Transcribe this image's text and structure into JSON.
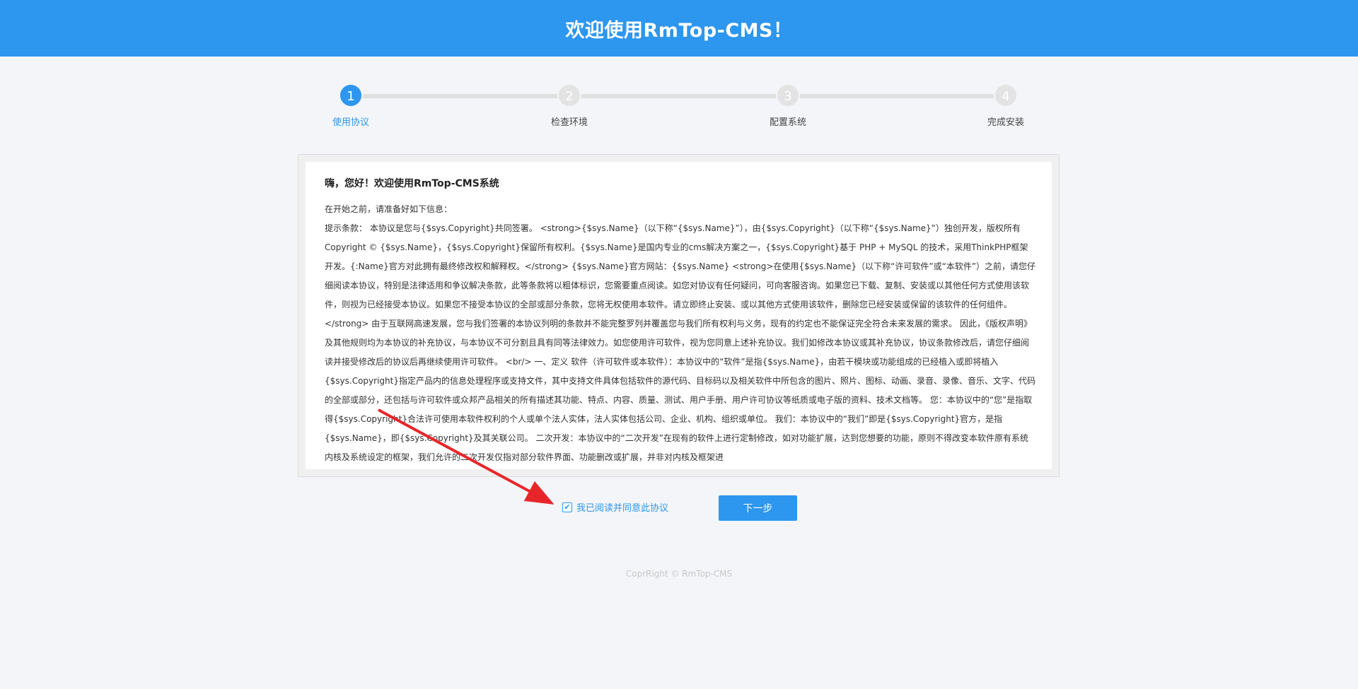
{
  "header": {
    "title": "欢迎使用RmTop-CMS！"
  },
  "steps": [
    {
      "number": "1",
      "label": "使用协议",
      "active": true
    },
    {
      "number": "2",
      "label": "检查环境",
      "active": false
    },
    {
      "number": "3",
      "label": "配置系统",
      "active": false
    },
    {
      "number": "4",
      "label": "完成安装",
      "active": false
    }
  ],
  "agreement": {
    "title": "嗨，您好！欢迎使用RmTop-CMS系统",
    "intro": "在开始之前，请准备好如下信息：",
    "body": "提示条款： 本协议是您与{$sys.Copyright}共同签署。 <strong>{$sys.Name}（以下称“{$sys.Name}”），由{$sys.Copyright}（以下称“{$sys.Name}”）独创开发，版权所有Copyright © {$sys.Name}，{$sys.Copyright}保留所有权利。{$sys.Name}是国内专业的cms解决方案之一，{$sys.Copyright}基于 PHP + MySQL 的技术，采用ThinkPHP框架开发。{:Name}官方对此拥有最终修改权和解释权。</strong> {$sys.Name}官方网站：{$sys.Name} <strong>在使用{$sys.Name}（以下称“许可软件”或“本软件”）之前，请您仔细阅读本协议，特别是法律适用和争议解决条款，此等条款将以粗体标识，您需要重点阅读。如您对协议有任何疑问，可向客服咨询。如果您已下载、复制、安装或以其他任何方式使用该软件，则视为已经接受本协议。如果您不接受本协议的全部或部分条款，您将无权使用本软件。请立即终止安装、或以其他方式使用该软件，删除您已经安装或保留的该软件的任何组件。</strong> 由于互联网高速发展，您与我们签署的本协议列明的条款并不能完整罗列并覆盖您与我们所有权利与义务，现有的约定也不能保证完全符合未来发展的需求。 因此，《版权声明》及其他规则均为本协议的补充协议，与本协议不可分割且具有同等法律效力。如您使用许可软件，视为您同意上述补充协议。我们如修改本协议或其补充协议，协议条款修改后，请您仔细阅读并接受修改后的协议后再继续使用许可软件。 <br/> 一、定义 软件（许可软件或本软件）：本协议中的“软件”是指{$sys.Name}，由若干模块或功能组成的已经植入或即将植入{$sys.Copyright}指定产品内的信息处理程序或支持文件，其中支持文件具体包括软件的源代码、目标码以及相关软件中所包含的图片、照片、图标、动画、录音、录像、音乐、文字、代码的全部或部分，还包括与许可软件或众邦产品相关的所有描述其功能、特点、内容、质量、测试、用户手册、用户许可协议等纸质或电子版的资料、技术文档等。 您：本协议中的“您”是指取得{$sys.Copyright}合法许可使用本软件权利的个人或单个法人实体，法人实体包括公司、企业、机构、组织或单位。 我们：本协议中的“我们”即是{$sys.Copyright}官方，是指{$sys.Name}，即{$sys.Copyright}及其关联公司。 二次开发：本协议中的“二次开发”在现有的软件上进行定制修改，如对功能扩展，达到您想要的功能，原则不得改变本软件原有系统内核及系统设定的框架，我们允许的二次开发仅指对部分软件界面、功能删改或扩展，并非对内核及框架进"
  },
  "actions": {
    "accept_label": "我已阅读并同意此协议",
    "accept_checked": true,
    "next_label": "下一步"
  },
  "footer": {
    "text": "CoprRight © RmTop-CMS"
  },
  "colors": {
    "accent": "#2d96ee",
    "annotation": "#e8262a"
  }
}
